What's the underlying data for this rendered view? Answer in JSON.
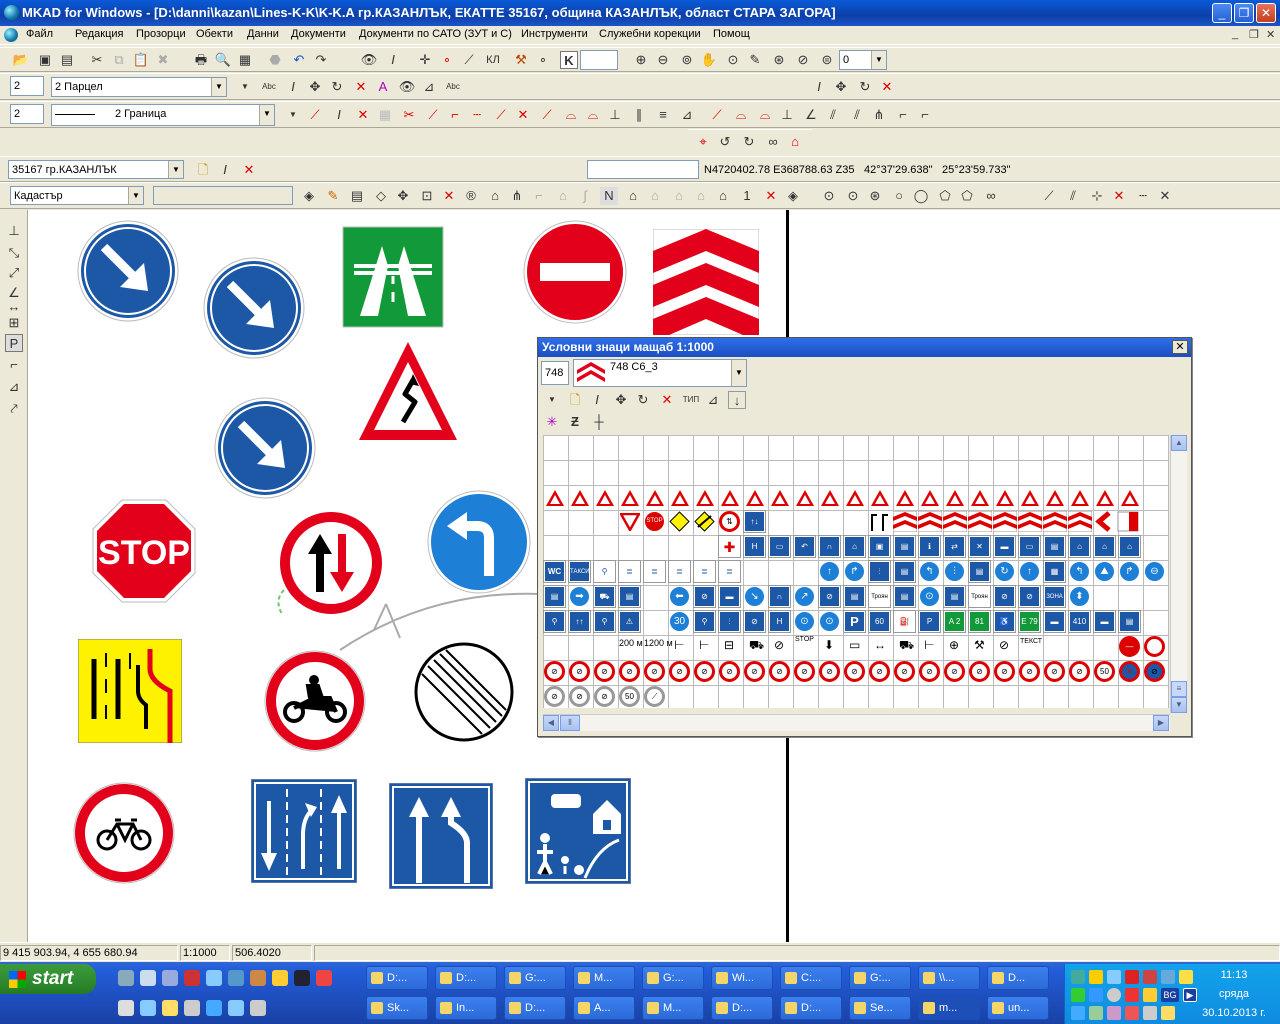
{
  "window": {
    "title": "MKAD for Windows - [D:\\danni\\kazan\\Lines-K-K\\K-K.A гр.КАЗАНЛЪК, ЕКАТТЕ 35167, община КАЗАНЛЪК, област СТАРА ЗАГОРА]",
    "min_label": "_",
    "max_label": "❐",
    "close_label": "✕"
  },
  "menu": {
    "items": [
      "Файл",
      "Редакция",
      "Прозорци",
      "Обекти",
      "Данни",
      "Документи",
      "Документи по САТО (ЗУТ и С)",
      "Инструменти",
      "Служебни корекции",
      "Помощ"
    ],
    "mdi": [
      "_",
      "❐",
      "✕"
    ]
  },
  "toolbar1": {
    "k_label": "K",
    "k_value": "",
    "zoom_value": "0",
    "kl_label": "КЛ"
  },
  "toolbar2": {
    "layer_num": "2",
    "layer_select": "2  Парцел",
    "abc_label": "Abc",
    "abc2_label": "Abc"
  },
  "toolbar3": {
    "layer_num": "2",
    "line_select": "2 Граница"
  },
  "location_bar": {
    "settlement": "35167 гр.КАЗАНЛЪК",
    "search_value": "",
    "coords": "N4720402.78 E368788.63 Z35",
    "lat": "42°37'29.638\"",
    "lon": "25°23'59.733\""
  },
  "object_bar": {
    "category": "Кадастър",
    "field2": ""
  },
  "signs_panel": {
    "title": "Условни знаци мащаб 1:1000",
    "close_label": "✕",
    "code": "748",
    "selected": "748 С6_3",
    "tip_label": "ТИП",
    "labels": {
      "wc": "WC",
      "taxi": "ТАКСИ",
      "n": "H",
      "p": "P",
      "thirty": "30",
      "sixty": "60",
      "a2": "A 2",
      "eighty_one": "81",
      "e79": "E 79",
      "four_ten": "410",
      "zona": "ЗОНА",
      "troyan": "Троян",
      "stop": "STOP",
      "two_hundred": "200 м",
      "twelve_hundred": "1200 м",
      "fifty": "50",
      "text": "ТЕКСТ"
    }
  },
  "status": {
    "coords": "9 415 903.94,  4 655 680.94",
    "scale": "1:1000",
    "value": "506.4020"
  },
  "taskbar": {
    "start_label": "start",
    "tasks_row1": [
      "D:...",
      "D:...",
      "G:...",
      "M...",
      "G:...",
      "Wi...",
      "C:...",
      "G:...",
      "\\\\...",
      "D..."
    ],
    "tasks_row2": [
      "Sk...",
      "In...",
      "D:...",
      "A...",
      "M...",
      "D:...",
      "D:...",
      "Se...",
      "m...",
      "un..."
    ],
    "time": "11:13",
    "day": "сряда",
    "date": "30.10.2013 г.",
    "tray_bg": "BG"
  },
  "colors": {
    "title_blue": "#0a5bd8",
    "sign_blue": "#1d58a6",
    "sign_red": "#d00000",
    "motorway_green": "#129a3a",
    "yellow": "#fff200"
  }
}
